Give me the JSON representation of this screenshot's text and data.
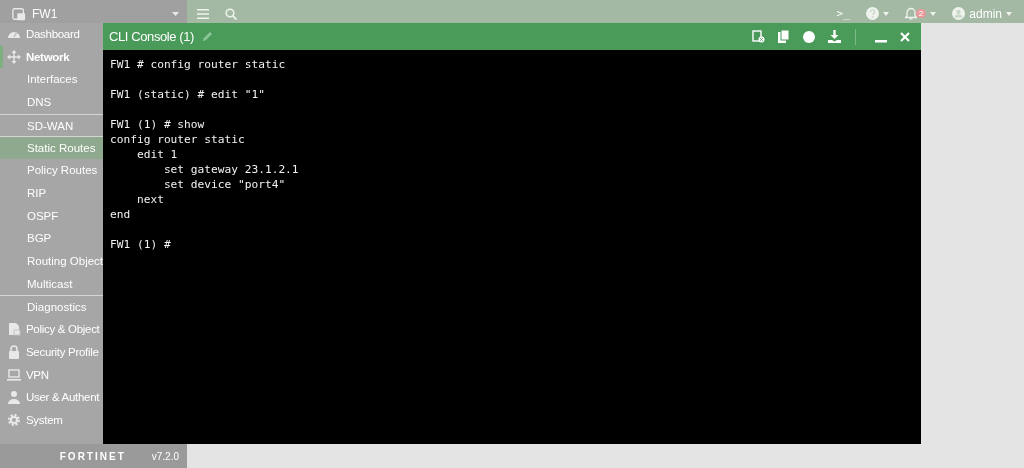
{
  "device": {
    "name": "FW1"
  },
  "sidebar": {
    "items": [
      {
        "label": "Dashboard",
        "selected": false
      },
      {
        "label": "Network",
        "selected": false,
        "expanded": true,
        "children": [
          {
            "label": "Interfaces",
            "selected": false
          },
          {
            "label": "DNS",
            "selected": false
          },
          {
            "label": "SD-WAN",
            "selected": false
          },
          {
            "label": "Static Routes",
            "selected": true
          },
          {
            "label": "Policy Routes",
            "selected": false
          },
          {
            "label": "RIP",
            "selected": false
          },
          {
            "label": "OSPF",
            "selected": false
          },
          {
            "label": "BGP",
            "selected": false
          },
          {
            "label": "Routing Object",
            "selected": false
          },
          {
            "label": "Multicast",
            "selected": false
          },
          {
            "label": "Diagnostics",
            "selected": false
          }
        ]
      },
      {
        "label": "Policy & Object",
        "selected": false
      },
      {
        "label": "Security Profile",
        "selected": false
      },
      {
        "label": "VPN",
        "selected": false
      },
      {
        "label": "User & Authent",
        "selected": false
      },
      {
        "label": "System",
        "selected": false
      }
    ],
    "logo": "FORTINET",
    "version": "v7.2.0"
  },
  "topbar": {
    "cli": ">_",
    "notifications": "2",
    "user": "admin"
  },
  "console": {
    "title": "CLI Console (1)",
    "blocks": [
      [
        "FW1 # config router static"
      ],
      [
        "FW1 (static) # edit \"1\""
      ],
      [
        "FW1 (1) # show",
        "config router static",
        "    edit 1",
        "        set gateway 23.1.2.1",
        "        set device \"port4\"",
        "    next",
        "end"
      ],
      [
        "FW1 (1) #"
      ]
    ]
  }
}
